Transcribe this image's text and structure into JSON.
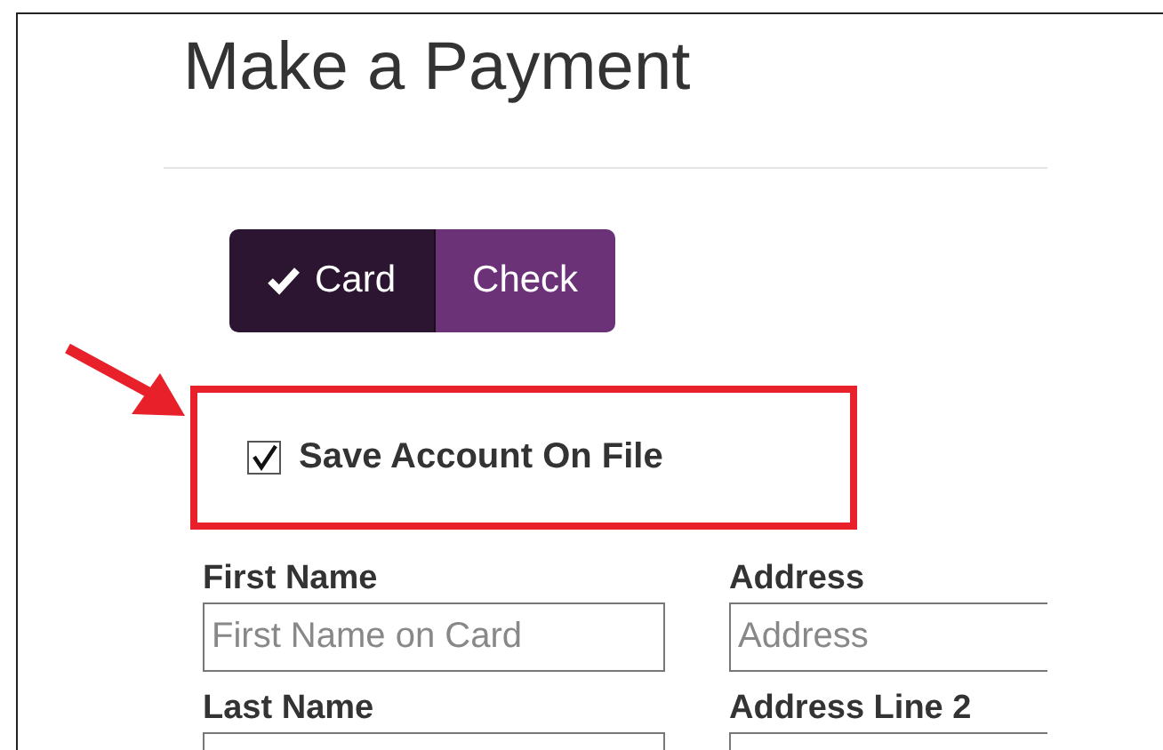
{
  "title": "Make a Payment",
  "payment_methods": [
    {
      "label": "Card",
      "selected": true
    },
    {
      "label": "Check",
      "selected": false
    }
  ],
  "save_account": {
    "label": "Save Account On File",
    "checked": true
  },
  "fields": [
    {
      "label": "First Name",
      "placeholder": "First Name on Card"
    },
    {
      "label": "Address",
      "placeholder": "Address"
    },
    {
      "label": "Last Name"
    },
    {
      "label": "Address Line 2"
    }
  ]
}
